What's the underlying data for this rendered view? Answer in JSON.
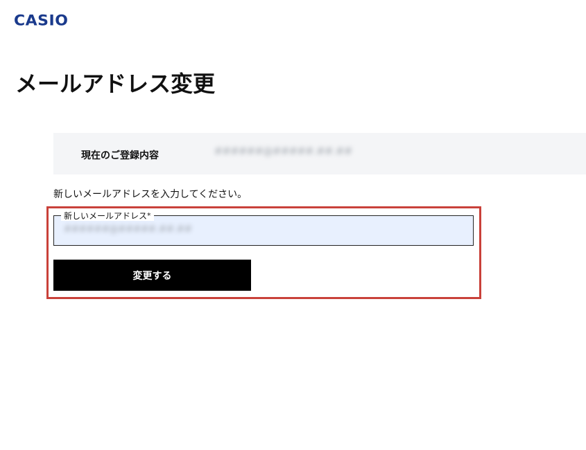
{
  "header": {
    "logo_text": "CASIO",
    "logo_color": "#1a3a8c"
  },
  "main": {
    "title": "メールアドレス変更",
    "current": {
      "label": "現在のご登録内容",
      "value": "######@#####.##.##"
    },
    "instruction": "新しいメールアドレスを入力してください。",
    "form": {
      "field_label": "新しいメールアドレス",
      "required_marker": "*",
      "field_value": "######@#####.##.##",
      "submit_label": "変更する"
    }
  },
  "colors": {
    "highlight": "#c9413a",
    "input_bg": "#e8f0fe",
    "current_box_bg": "#f4f5f7",
    "button_bg": "#000000"
  }
}
